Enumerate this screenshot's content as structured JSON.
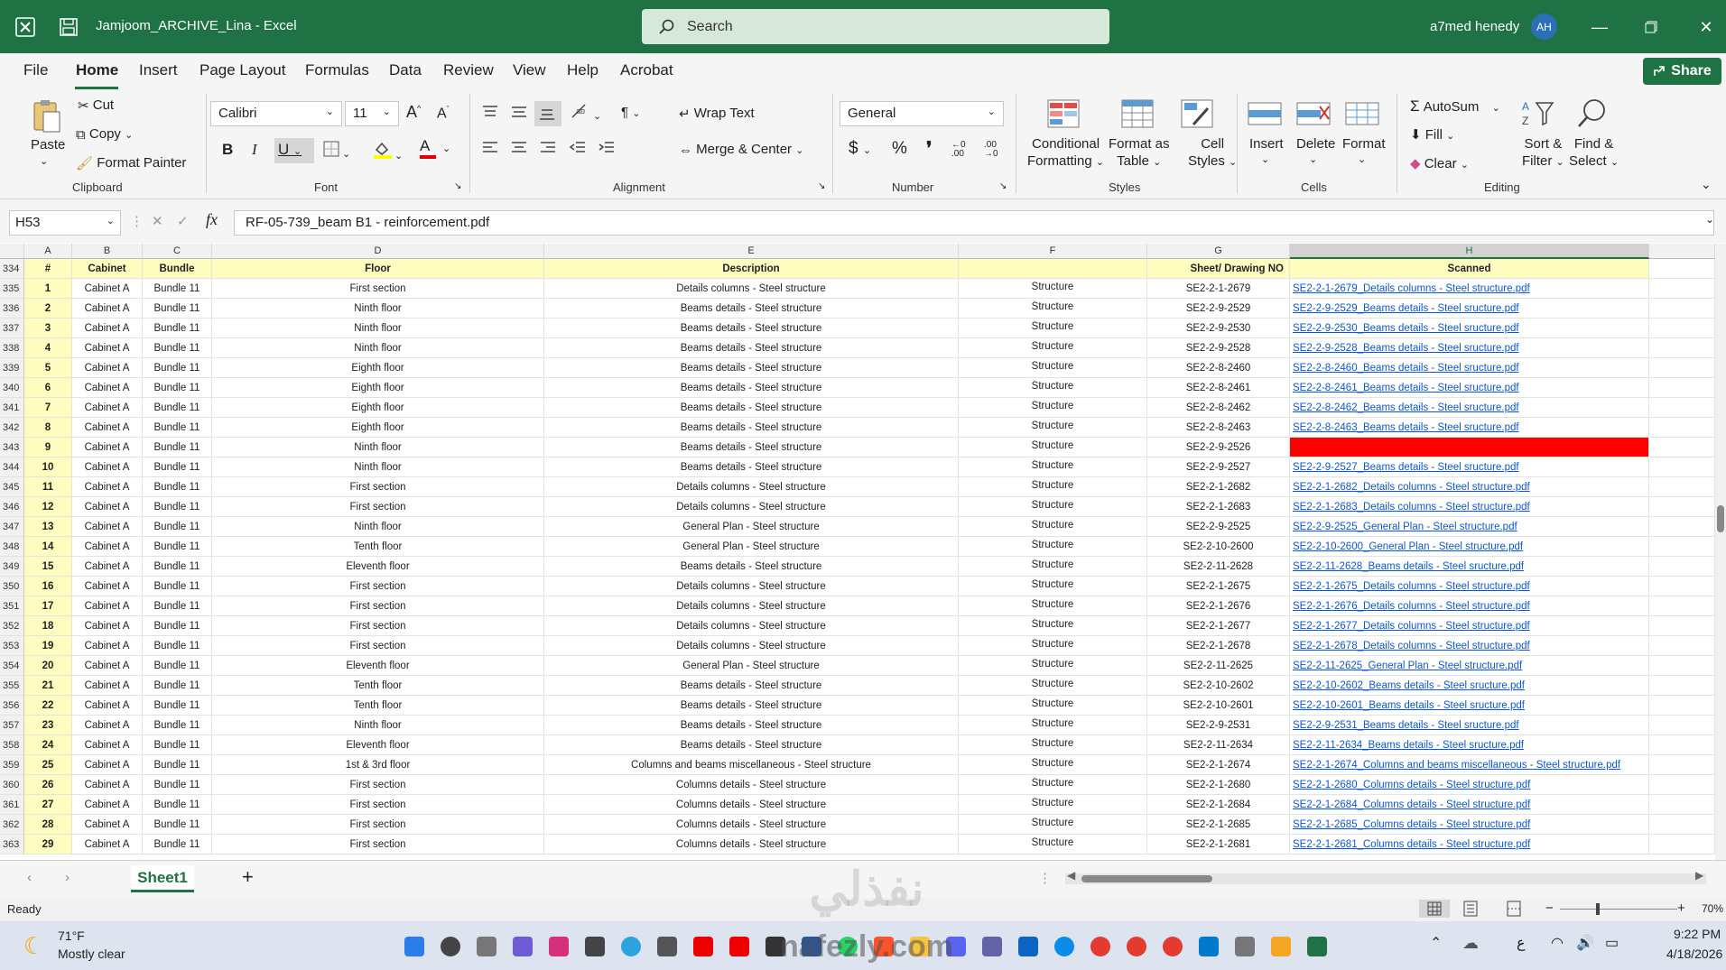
{
  "window": {
    "title": "Jamjoom_ARCHIVE_Lina  -  Excel",
    "user": "a7med henedy",
    "avatar": "AH"
  },
  "search": {
    "placeholder": "Search"
  },
  "menu": [
    "File",
    "Home",
    "Insert",
    "Page Layout",
    "Formulas",
    "Data",
    "Review",
    "View",
    "Help",
    "Acrobat"
  ],
  "share_label": "Share",
  "ribbon": {
    "clipboard": {
      "paste": "Paste",
      "cut": "Cut",
      "copy": "Copy",
      "format_painter": "Format Painter",
      "group": "Clipboard"
    },
    "font": {
      "name": "Calibri",
      "size": "11",
      "group": "Font"
    },
    "alignment": {
      "wrap": "Wrap Text",
      "merge": "Merge & Center",
      "group": "Alignment"
    },
    "number": {
      "format": "General",
      "group": "Number"
    },
    "styles": {
      "conditional": "Conditional",
      "conditional2": "Formatting",
      "format_table": "Format as",
      "format_table2": "Table",
      "cell_styles": "Cell",
      "cell_styles2": "Styles",
      "group": "Styles"
    },
    "cells": {
      "insert": "Insert",
      "delete": "Delete",
      "format": "Format",
      "group": "Cells"
    },
    "editing": {
      "autosum": "AutoSum",
      "fill": "Fill",
      "clear": "Clear",
      "sort": "Sort &",
      "sort2": "Filter",
      "find": "Find &",
      "find2": "Select",
      "group": "Editing"
    }
  },
  "formula_bar": {
    "name_box": "H53",
    "formula": "RF-05-739_beam B1 - reinforcement.pdf"
  },
  "columns": [
    "A",
    "B",
    "C",
    "D",
    "E",
    "F",
    "G",
    "H"
  ],
  "header_row": {
    "row": "334",
    "cols": [
      "#",
      "Cabinet",
      "Bundle",
      "Floor",
      "Description",
      "",
      "Sheet/ Drawing NO",
      "Scanned"
    ]
  },
  "rows": [
    {
      "r": "335",
      "n": "1",
      "b": "Cabinet A",
      "c": "Bundle 11",
      "d": "First section",
      "e": "Details columns - Steel structure",
      "f": "Structure",
      "g": "SE2-2-1-2679",
      "h": "SE2-2-1-2679_Details columns - Steel structure.pdf"
    },
    {
      "r": "336",
      "n": "2",
      "b": "Cabinet A",
      "c": "Bundle 11",
      "d": "Ninth floor",
      "e": "Beams details - Steel structure",
      "f": "Structure",
      "g": "SE2-2-9-2529",
      "h": "SE2-2-9-2529_Beams details - Steel sructure.pdf"
    },
    {
      "r": "337",
      "n": "3",
      "b": "Cabinet A",
      "c": "Bundle 11",
      "d": "Ninth floor",
      "e": "Beams details - Steel structure",
      "f": "Structure",
      "g": "SE2-2-9-2530",
      "h": "SE2-2-9-2530_Beams details - Steel sructure.pdf"
    },
    {
      "r": "338",
      "n": "4",
      "b": "Cabinet A",
      "c": "Bundle 11",
      "d": "Ninth floor",
      "e": "Beams details - Steel structure",
      "f": "Structure",
      "g": "SE2-2-9-2528",
      "h": "SE2-2-9-2528_Beams details - Steel sructure.pdf"
    },
    {
      "r": "339",
      "n": "5",
      "b": "Cabinet A",
      "c": "Bundle 11",
      "d": "Eighth floor",
      "e": "Beams details - Steel structure",
      "f": "Structure",
      "g": "SE2-2-8-2460",
      "h": "SE2-2-8-2460_Beams details - Steel sructure.pdf"
    },
    {
      "r": "340",
      "n": "6",
      "b": "Cabinet A",
      "c": "Bundle 11",
      "d": "Eighth floor",
      "e": "Beams details - Steel structure",
      "f": "Structure",
      "g": "SE2-2-8-2461",
      "h": "SE2-2-8-2461_Beams details - Steel sructure.pdf"
    },
    {
      "r": "341",
      "n": "7",
      "b": "Cabinet A",
      "c": "Bundle 11",
      "d": "Eighth floor",
      "e": "Beams details - Steel structure",
      "f": "Structure",
      "g": "SE2-2-8-2462",
      "h": "SE2-2-8-2462_Beams details - Steel sructure.pdf"
    },
    {
      "r": "342",
      "n": "8",
      "b": "Cabinet A",
      "c": "Bundle 11",
      "d": "Eighth floor",
      "e": "Beams details - Steel structure",
      "f": "Structure",
      "g": "SE2-2-8-2463",
      "h": "SE2-2-8-2463_Beams details - Steel sructure.pdf"
    },
    {
      "r": "343",
      "n": "9",
      "b": "Cabinet A",
      "c": "Bundle 11",
      "d": "Ninth floor",
      "e": "Beams details - Steel structure",
      "f": "Structure",
      "g": "SE2-2-9-2526",
      "h": "",
      "red": true
    },
    {
      "r": "344",
      "n": "10",
      "b": "Cabinet A",
      "c": "Bundle 11",
      "d": "Ninth floor",
      "e": "Beams details - Steel structure",
      "f": "Structure",
      "g": "SE2-2-9-2527",
      "h": "SE2-2-9-2527_Beams details - Steel sructure.pdf"
    },
    {
      "r": "345",
      "n": "11",
      "b": "Cabinet A",
      "c": "Bundle 11",
      "d": "First section",
      "e": "Details columns - Steel structure",
      "f": "Structure",
      "g": "SE2-2-1-2682",
      "h": "SE2-2-1-2682_Details columns - Steel structure.pdf"
    },
    {
      "r": "346",
      "n": "12",
      "b": "Cabinet A",
      "c": "Bundle 11",
      "d": "First section",
      "e": "Details columns - Steel structure",
      "f": "Structure",
      "g": "SE2-2-1-2683",
      "h": "SE2-2-1-2683_Details columns - Steel structure.pdf"
    },
    {
      "r": "347",
      "n": "13",
      "b": "Cabinet A",
      "c": "Bundle 11",
      "d": "Ninth floor",
      "e": "General Plan - Steel structure",
      "f": "Structure",
      "g": "SE2-2-9-2525",
      "h": "SE2-2-9-2525_General Plan - Steel structure.pdf"
    },
    {
      "r": "348",
      "n": "14",
      "b": "Cabinet A",
      "c": "Bundle 11",
      "d": "Tenth floor",
      "e": "General Plan - Steel structure",
      "f": "Structure",
      "g": "SE2-2-10-2600",
      "h": "SE2-2-10-2600_General Plan - Steel structure.pdf"
    },
    {
      "r": "349",
      "n": "15",
      "b": "Cabinet A",
      "c": "Bundle 11",
      "d": "Eleventh floor",
      "e": "Beams details - Steel structure",
      "f": "Structure",
      "g": "SE2-2-11-2628",
      "h": "SE2-2-11-2628_Beams details - Steel sructure.pdf"
    },
    {
      "r": "350",
      "n": "16",
      "b": "Cabinet A",
      "c": "Bundle 11",
      "d": "First section",
      "e": "Details columns - Steel structure",
      "f": "Structure",
      "g": "SE2-2-1-2675",
      "h": "SE2-2-1-2675_Details columns - Steel structure.pdf"
    },
    {
      "r": "351",
      "n": "17",
      "b": "Cabinet A",
      "c": "Bundle 11",
      "d": "First section",
      "e": "Details columns - Steel structure",
      "f": "Structure",
      "g": "SE2-2-1-2676",
      "h": "SE2-2-1-2676_Details columns - Steel structure.pdf"
    },
    {
      "r": "352",
      "n": "18",
      "b": "Cabinet A",
      "c": "Bundle 11",
      "d": "First section",
      "e": "Details columns - Steel structure",
      "f": "Structure",
      "g": "SE2-2-1-2677",
      "h": "SE2-2-1-2677_Details columns - Steel structure.pdf"
    },
    {
      "r": "353",
      "n": "19",
      "b": "Cabinet A",
      "c": "Bundle 11",
      "d": "First section",
      "e": "Details columns - Steel structure",
      "f": "Structure",
      "g": "SE2-2-1-2678",
      "h": "SE2-2-1-2678_Details columns - Steel structure.pdf"
    },
    {
      "r": "354",
      "n": "20",
      "b": "Cabinet A",
      "c": "Bundle 11",
      "d": "Eleventh floor",
      "e": "General Plan - Steel structure",
      "f": "Structure",
      "g": "SE2-2-11-2625",
      "h": "SE2-2-11-2625_General Plan - Steel structure.pdf"
    },
    {
      "r": "355",
      "n": "21",
      "b": "Cabinet A",
      "c": "Bundle 11",
      "d": "Tenth floor",
      "e": "Beams details - Steel structure",
      "f": "Structure",
      "g": "SE2-2-10-2602",
      "h": "SE2-2-10-2602_Beams details - Steel sructure.pdf"
    },
    {
      "r": "356",
      "n": "22",
      "b": "Cabinet A",
      "c": "Bundle 11",
      "d": "Tenth floor",
      "e": "Beams details - Steel structure",
      "f": "Structure",
      "g": "SE2-2-10-2601",
      "h": "SE2-2-10-2601_Beams details - Steel sructure.pdf"
    },
    {
      "r": "357",
      "n": "23",
      "b": "Cabinet A",
      "c": "Bundle 11",
      "d": "Ninth floor",
      "e": "Beams details - Steel structure",
      "f": "Structure",
      "g": "SE2-2-9-2531",
      "h": "SE2-2-9-2531_Beams details - Steel sructure.pdf"
    },
    {
      "r": "358",
      "n": "24",
      "b": "Cabinet A",
      "c": "Bundle 11",
      "d": "Eleventh floor",
      "e": "Beams details - Steel structure",
      "f": "Structure",
      "g": "SE2-2-11-2634",
      "h": "SE2-2-11-2634_Beams details - Steel sructure.pdf"
    },
    {
      "r": "359",
      "n": "25",
      "b": "Cabinet A",
      "c": "Bundle 11",
      "d": "1st & 3rd floor",
      "e": "Columns and beams miscellaneous - Steel structure",
      "f": "Structure",
      "g": "SE2-2-1-2674",
      "h": "SE2-2-1-2674_Columns and beams miscellaneous - Steel structure.pdf"
    },
    {
      "r": "360",
      "n": "26",
      "b": "Cabinet A",
      "c": "Bundle 11",
      "d": "First section",
      "e": "Columns details - Steel structure",
      "f": "Structure",
      "g": "SE2-2-1-2680",
      "h": "SE2-2-1-2680_Columns details - Steel structure.pdf"
    },
    {
      "r": "361",
      "n": "27",
      "b": "Cabinet A",
      "c": "Bundle 11",
      "d": "First section",
      "e": "Columns details - Steel structure",
      "f": "Structure",
      "g": "SE2-2-1-2684",
      "h": "SE2-2-1-2684_Columns details - Steel structure.pdf"
    },
    {
      "r": "362",
      "n": "28",
      "b": "Cabinet A",
      "c": "Bundle 11",
      "d": "First section",
      "e": "Columns details - Steel structure",
      "f": "Structure",
      "g": "SE2-2-1-2685",
      "h": "SE2-2-1-2685_Columns details - Steel structure.pdf"
    },
    {
      "r": "363",
      "n": "29",
      "b": "Cabinet A",
      "c": "Bundle 11",
      "d": "First section",
      "e": "Columns details - Steel structure",
      "f": "Structure",
      "g": "SE2-2-1-2681",
      "h": "SE2-2-1-2681_Columns details - Steel structure.pdf"
    }
  ],
  "sheet_tabs": {
    "active": "Sheet1"
  },
  "status": {
    "ready": "Ready",
    "zoom": "70%"
  },
  "taskbar": {
    "temp": "71°F",
    "weather": "Mostly clear",
    "time": "9:22 PM",
    "date": "4/18/2026",
    "ime": "ع"
  },
  "watermark": {
    "arabic": "نفذلي",
    "latin": "nafezly.com"
  },
  "colors": {
    "excel_green": "#1f7244",
    "header_yellow": "#fffcc0",
    "missing_red": "#ff0000",
    "link_blue": "#0b57d0"
  }
}
